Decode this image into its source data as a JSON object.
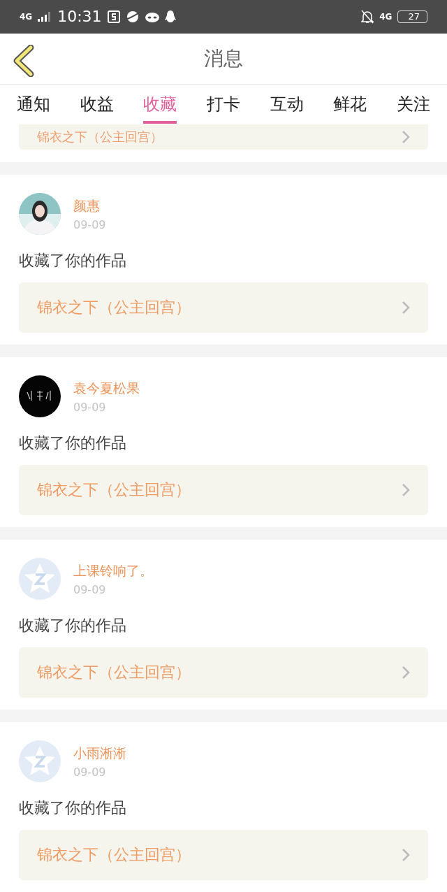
{
  "status_bar": {
    "network_left": "4G",
    "time": "10:31",
    "network_right": "4G",
    "battery": "27"
  },
  "header": {
    "title": "消息"
  },
  "tabs": [
    {
      "label": "通知",
      "selected": false
    },
    {
      "label": "收益",
      "selected": false
    },
    {
      "label": "收藏",
      "selected": true
    },
    {
      "label": "打卡",
      "selected": false
    },
    {
      "label": "互动",
      "selected": false
    },
    {
      "label": "鲜花",
      "selected": false
    },
    {
      "label": "关注",
      "selected": false
    }
  ],
  "partial_item": {
    "work": "锦衣之下（公主回宫）"
  },
  "items": [
    {
      "name": "颜惠",
      "date": "09-09",
      "message": "收藏了你的作品",
      "work": "锦衣之下（公主回宫）"
    },
    {
      "name": "袁今夏松果",
      "date": "09-09",
      "message": "收藏了你的作品",
      "work": "锦衣之下（公主回宫）"
    },
    {
      "avatar": {
        "kind": "default"
      },
      "name": "上课铃响了。",
      "date": "09-09",
      "message": "收藏了你的作品",
      "work": "锦衣之下（公主回宫）"
    },
    {
      "avatar": {
        "kind": "default"
      },
      "name": "小雨淅淅",
      "date": "09-09",
      "message": "收藏了你的作品",
      "work": "锦衣之下（公主回宫）"
    }
  ]
}
